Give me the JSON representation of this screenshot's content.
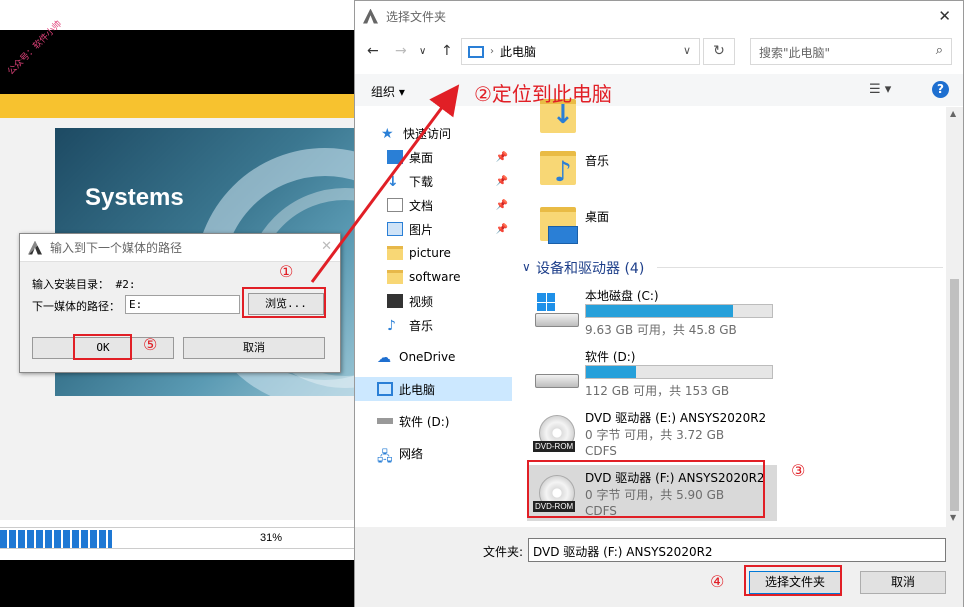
{
  "background": {
    "banner_text": "Systems",
    "watermark": "公众号：软件小帅",
    "progress": {
      "percent_label": "31%",
      "fraction": 0.31
    }
  },
  "small_dialog": {
    "title": "输入到下一个媒体的路径",
    "install_dir_label": "输入安装目录：  #2:",
    "path_label": "下一媒体的路径：",
    "path_value": "E:",
    "browse_label": "浏览...",
    "ok_label": "OK",
    "cancel_label": "取消"
  },
  "picker": {
    "title": "选择文件夹",
    "address": "此电脑",
    "search_placeholder": "搜索\"此电脑\"",
    "organize_label": "组织 ▾",
    "tree": [
      {
        "label": "快速访问",
        "icon": "star-icon"
      },
      {
        "label": "桌面",
        "icon": "desktop-icon",
        "pinned": true
      },
      {
        "label": "下载",
        "icon": "download-icon",
        "pinned": true
      },
      {
        "label": "文档",
        "icon": "document-icon",
        "pinned": true
      },
      {
        "label": "图片",
        "icon": "picture-icon",
        "pinned": true
      },
      {
        "label": "picture",
        "icon": "folder-icon"
      },
      {
        "label": "software",
        "icon": "folder-icon"
      },
      {
        "label": "视频",
        "icon": "video-icon"
      },
      {
        "label": "音乐",
        "icon": "music-icon"
      },
      {
        "label": "OneDrive",
        "icon": "cloud-icon"
      },
      {
        "label": "此电脑",
        "icon": "pc-icon",
        "selected": true
      },
      {
        "label": "软件 (D:)",
        "icon": "drive-icon"
      },
      {
        "label": "网络",
        "icon": "network-icon"
      }
    ],
    "folders": [
      {
        "label": "下载"
      },
      {
        "label": "音乐"
      },
      {
        "label": "桌面"
      }
    ],
    "group_header": "设备和驱动器 (4)",
    "drives": [
      {
        "name": "本地磁盘 (C:)",
        "info": "9.63 GB 可用，共 45.8 GB",
        "used_fraction": 0.79,
        "kind": "hdd-windows"
      },
      {
        "name": "软件 (D:)",
        "info": "112 GB 可用，共 153 GB",
        "used_fraction": 0.27,
        "kind": "hdd"
      },
      {
        "name": "DVD 驱动器 (E:) ANSYS2020R2",
        "info": "0 字节 可用，共 3.72 GB",
        "fs": "CDFS",
        "kind": "dvd",
        "badge": "DVD-ROM"
      },
      {
        "name": "DVD 驱动器 (F:) ANSYS2020R2",
        "info": "0 字节 可用，共 5.90 GB",
        "fs": "CDFS",
        "kind": "dvd",
        "badge": "DVD-ROM",
        "selected": true
      }
    ],
    "folder_label": "文件夹:",
    "folder_value": "DVD 驱动器 (F:) ANSYS2020R2",
    "select_label": "选择文件夹",
    "cancel_label": "取消"
  },
  "annotations": {
    "step1": "①",
    "step2": "②定位到此电脑",
    "step3": "③",
    "step4": "④",
    "step5": "⑤",
    "color": "#e11f26"
  }
}
